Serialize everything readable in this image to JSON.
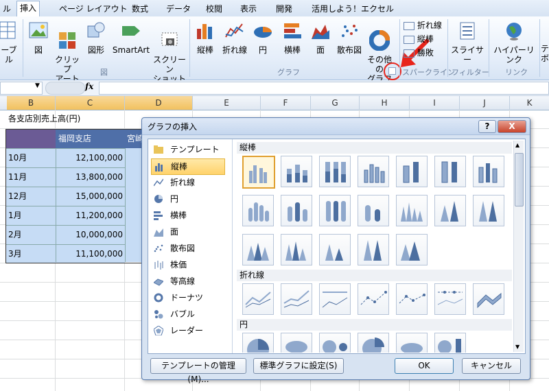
{
  "ribbon": {
    "tabs": [
      "ル",
      "挿入",
      "ページ レイアウト",
      "数式",
      "データ",
      "校閲",
      "表示",
      "開発",
      "活用しよう！エクセル"
    ],
    "buttons": {
      "table": "ーブル",
      "picture": "図",
      "clipart": "クリップ\nアート",
      "shapes": "図形",
      "smartart": "SmartArt",
      "screenshot": "スクリーン\nショット",
      "column": "縦棒",
      "line": "折れ線",
      "pie": "円",
      "bar": "横棒",
      "area": "面",
      "scatter": "散布図",
      "other": "その他の\nグラフ",
      "spark_line": "折れ線",
      "spark_column": "縦棒",
      "spark_winloss": "勝敗",
      "slicer": "スライサー",
      "hyperlink": "ハイパーリンク",
      "text_partial": "テ\nボ"
    },
    "groups": {
      "illustrations": "図",
      "charts": "グラフ",
      "sparklines": "スパークライン",
      "filter": "フィルター",
      "links": "リンク"
    }
  },
  "formula_bar": {
    "fx": "fx",
    "name_box_arrow": "▼"
  },
  "grid": {
    "columns": [
      "B",
      "C",
      "D",
      "E",
      "F",
      "G",
      "H",
      "I",
      "J",
      "K"
    ],
    "title": "各支店別売上高(円)",
    "header": [
      "",
      "福岡支店",
      "宮崎"
    ],
    "rows": [
      {
        "month": "10月",
        "value": "12,100,000"
      },
      {
        "month": "11月",
        "value": "13,800,000"
      },
      {
        "month": "12月",
        "value": "15,000,000"
      },
      {
        "month": "1月",
        "value": "11,200,000"
      },
      {
        "month": "2月",
        "value": "10,000,000"
      },
      {
        "month": "3月",
        "value": "11,100,000"
      }
    ]
  },
  "dialog": {
    "title": "グラフの挿入",
    "help": "?",
    "close": "X",
    "categories": [
      "テンプレート",
      "縦棒",
      "折れ線",
      "円",
      "横棒",
      "面",
      "散布図",
      "株価",
      "等高線",
      "ドーナツ",
      "バブル",
      "レーダー"
    ],
    "sections": [
      "縦棒",
      "折れ線",
      "円"
    ],
    "buttons": {
      "manage_templates": "テンプレートの管理(M)...",
      "set_default": "標準グラフに設定(S)",
      "ok": "OK",
      "cancel": "キャンセル"
    }
  },
  "colors": {
    "accent_selected": "#f1c15f",
    "table_header": "#4f6fa8",
    "table_cells": "#c6dcf5",
    "red_arrow": "#e8241b"
  }
}
